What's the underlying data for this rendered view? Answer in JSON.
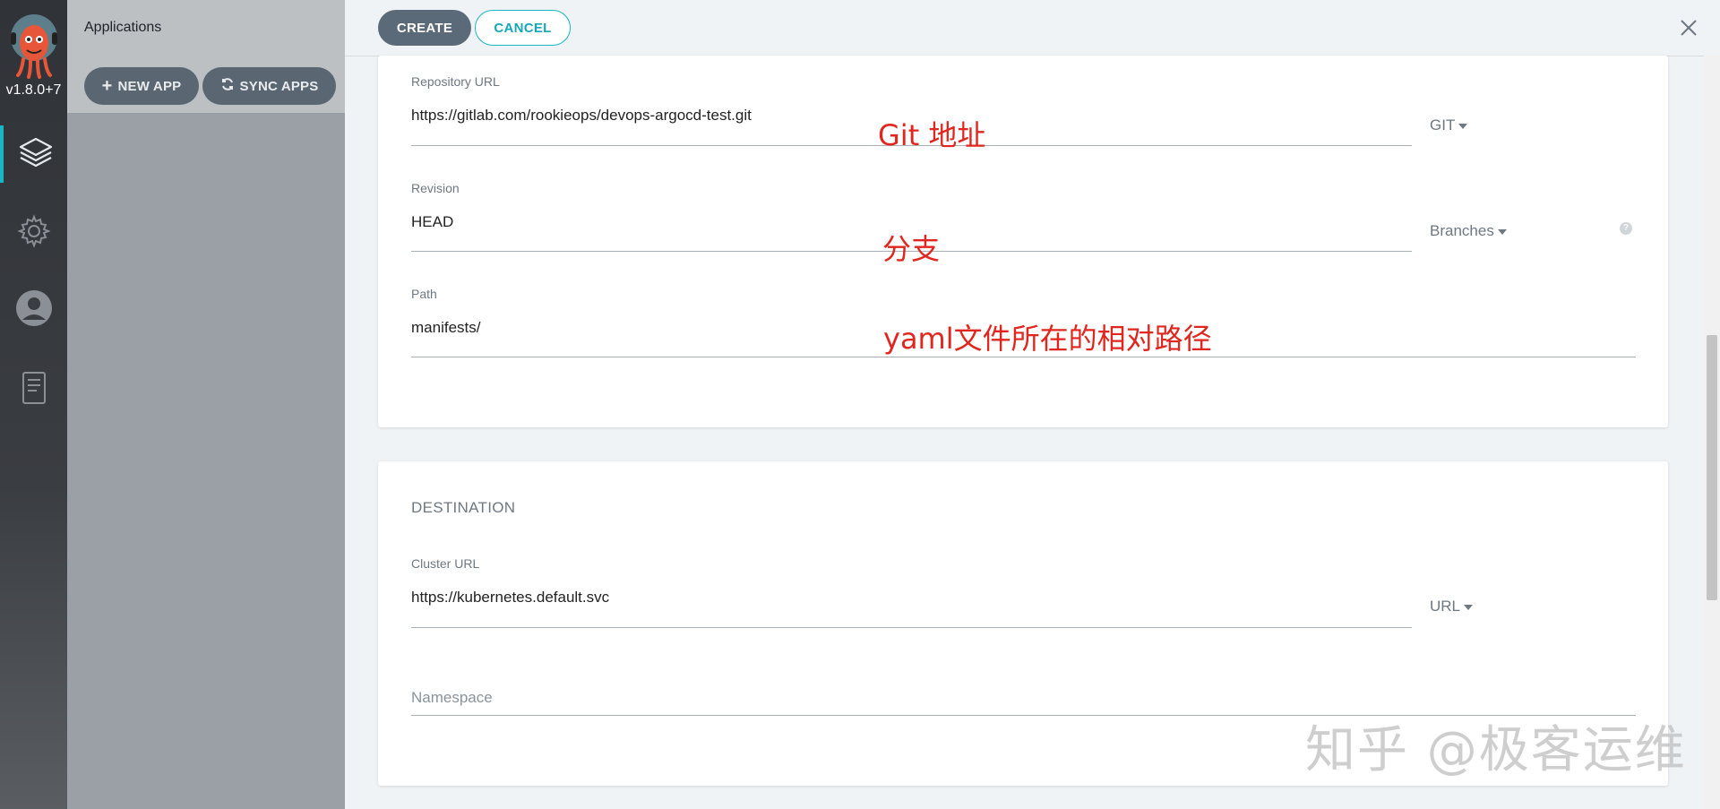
{
  "nav": {
    "version": "v1.8.0+7",
    "items": [
      {
        "name": "applications",
        "icon": "layers-icon"
      },
      {
        "name": "settings",
        "icon": "gear-icon"
      },
      {
        "name": "user-info",
        "icon": "user-icon"
      },
      {
        "name": "docs",
        "icon": "book-icon"
      }
    ]
  },
  "panel": {
    "title": "Applications",
    "new_app": "NEW APP",
    "sync_apps": "SYNC APPS"
  },
  "toolbar": {
    "create": "CREATE",
    "cancel": "CANCEL"
  },
  "source": {
    "repo_label": "Repository URL",
    "repo_value": "https://gitlab.com/rookieops/devops-argocd-test.git",
    "repo_type": "GIT",
    "revision_label": "Revision",
    "revision_value": "HEAD",
    "revision_type": "Branches",
    "path_label": "Path",
    "path_value": "manifests/"
  },
  "annotations": {
    "git": "Git 地址",
    "branch": "分支",
    "path": "yaml文件所在的相对路径"
  },
  "destination": {
    "title": "DESTINATION",
    "cluster_label": "Cluster URL",
    "cluster_value": "https://kubernetes.default.svc",
    "cluster_type": "URL",
    "namespace_placeholder": "Namespace"
  },
  "watermark": "知乎 @极客运维",
  "colors": {
    "accent": "#18b6c7",
    "annotation": "#e0261e",
    "primary_button": "#5b6a78"
  }
}
